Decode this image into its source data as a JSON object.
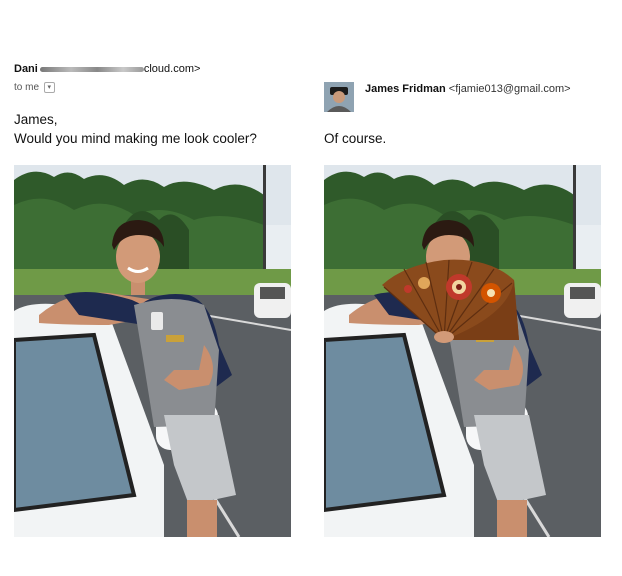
{
  "request": {
    "sender_name": "Dani",
    "sender_email_suffix": "cloud.com>",
    "to_label": "to me",
    "greeting": "James,",
    "message": "Would you mind making me look cooler?"
  },
  "reply": {
    "sender_name": "James Fridman",
    "sender_email": "<fjamie013@gmail.com>",
    "message": "Of course."
  },
  "icons": {
    "dropdown": "chevron-down-icon",
    "avatar": "avatar-photo"
  },
  "colors": {
    "fan_main": "#8a4a1c",
    "fan_accent": "#c0392b",
    "car_white": "#f2f4f5",
    "shirt_navy": "#1e2a4f"
  }
}
